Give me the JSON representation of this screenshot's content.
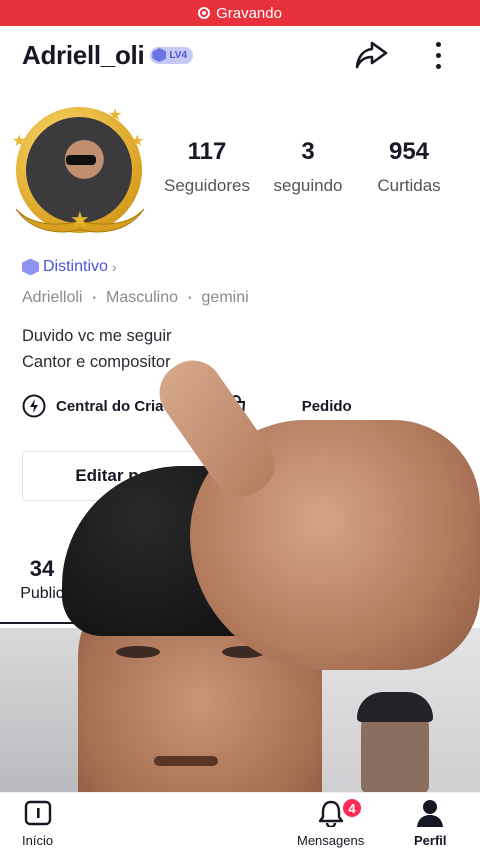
{
  "recording_bar": {
    "label": "Gravando",
    "color": "#e9313b"
  },
  "header": {
    "username": "Adriell_oli",
    "level_badge": "LV4",
    "icons": {
      "share": "share-icon",
      "more": "more-vertical-icon"
    }
  },
  "profile": {
    "avatar_frame": "gold-laurel-frame",
    "stats": [
      {
        "value": "117",
        "label": "Seguidores"
      },
      {
        "value": "3",
        "label": "seguindo"
      },
      {
        "value": "954",
        "label": "Curtidas"
      }
    ],
    "badge": {
      "label": "Distintivo",
      "chevron": "›"
    },
    "meta": [
      "Adrielloli",
      "Masculino",
      "gemini"
    ],
    "meta_separator": "•",
    "bio": [
      "Duvido vc me seguir",
      "Cantor e compositor"
    ]
  },
  "quick_links": [
    {
      "label": "Central do Criador",
      "icon": "lightning-icon"
    },
    {
      "label": "Pedido",
      "icon": "shopping-bag-icon"
    }
  ],
  "actions": {
    "edit_label": "Editar per"
  },
  "tabs": [
    {
      "count": "34",
      "label": "Public"
    }
  ],
  "bottom_nav": [
    {
      "label": "Início",
      "icon": "home-icon"
    },
    {
      "label": "Mensagens",
      "icon": "bell-icon",
      "badge": "4"
    },
    {
      "label": "Perfil",
      "icon": "person-icon"
    }
  ],
  "colors": {
    "accent": "#fe2c55",
    "badge_purple": "#4d55d9",
    "gold": "#d9a020"
  }
}
